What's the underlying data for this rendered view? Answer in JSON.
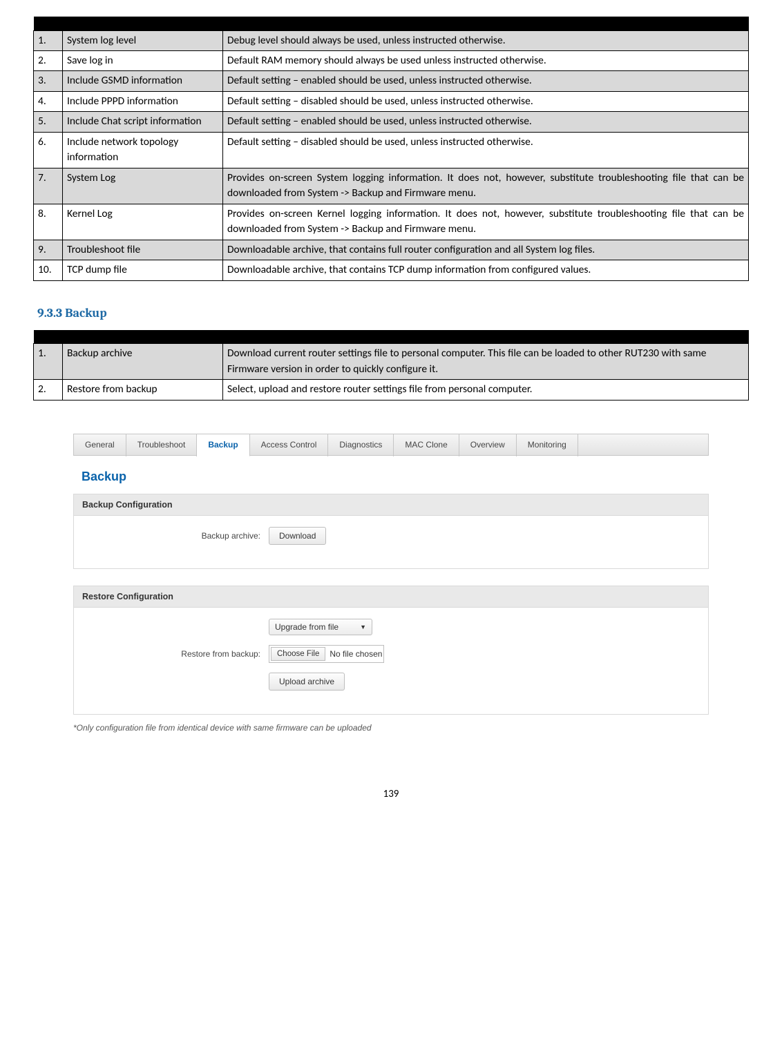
{
  "table1": {
    "rows": [
      {
        "num": "1.",
        "name": "System log level",
        "expl": "Debug level should always be used, unless instructed otherwise.",
        "justify": false,
        "white": false
      },
      {
        "num": "2.",
        "name": "Save log in",
        "expl": "Default RAM memory should always be used unless instructed otherwise.",
        "justify": false,
        "white": true
      },
      {
        "num": "3.",
        "name": "Include GSMD information",
        "expl": "Default setting – enabled should be used, unless instructed otherwise.",
        "justify": false,
        "white": false
      },
      {
        "num": "4.",
        "name": "Include PPPD information",
        "expl": "Default setting – disabled should be used, unless instructed otherwise.",
        "justify": false,
        "white": true
      },
      {
        "num": "5.",
        "name": "Include Chat script information",
        "expl": "Default setting – enabled should be used, unless instructed otherwise.",
        "justify": false,
        "white": false
      },
      {
        "num": "6.",
        "name": "Include network topology information",
        "expl": "Default setting – disabled should be used, unless instructed otherwise.",
        "justify": false,
        "white": true
      },
      {
        "num": "7.",
        "name": "System Log",
        "expl": "Provides on-screen System logging information. It does not, however, substitute troubleshooting file that can be downloaded from System -> Backup and Firmware menu.",
        "justify": true,
        "white": false
      },
      {
        "num": "8.",
        "name": "Kernel Log",
        "expl": "Provides on-screen Kernel logging information. It does not, however, substitute troubleshooting file that can be downloaded from System -> Backup and Firmware menu.",
        "justify": true,
        "white": true
      },
      {
        "num": "9.",
        "name": "Troubleshoot file",
        "expl": "Downloadable archive, that contains full router configuration and all System log files.",
        "justify": true,
        "white": false
      },
      {
        "num": "10.",
        "name": "TCP dump file",
        "expl": "Downloadable archive, that contains TCP dump information from configured values.",
        "justify": false,
        "white": true
      }
    ]
  },
  "section_heading": "9.3.3 Backup",
  "table2": {
    "rows": [
      {
        "num": "1.",
        "name": "Backup archive",
        "expl": "Download current router settings file to personal computer. This file can be loaded to other RUT230 with same Firmware version in order to quickly configure it.",
        "justify": false,
        "white": false
      },
      {
        "num": "2.",
        "name": "Restore from backup",
        "expl": "Select, upload and restore router settings file from personal computer.",
        "justify": false,
        "white": true
      }
    ]
  },
  "ui": {
    "tabs": [
      "General",
      "Troubleshoot",
      "Backup",
      "Access Control",
      "Diagnostics",
      "MAC Clone",
      "Overview",
      "Monitoring"
    ],
    "active_tab_index": 2,
    "page_title": "Backup",
    "panel1_title": "Backup Configuration",
    "backup_archive_label": "Backup archive:",
    "download_btn": "Download",
    "panel2_title": "Restore Configuration",
    "upgrade_select": "Upgrade from file",
    "restore_label": "Restore from backup:",
    "choose_file_btn": "Choose File",
    "no_file_text": "No file chosen",
    "upload_btn": "Upload archive",
    "footnote": "*Only configuration file from identical device with same firmware can be uploaded"
  },
  "page_number": "139"
}
